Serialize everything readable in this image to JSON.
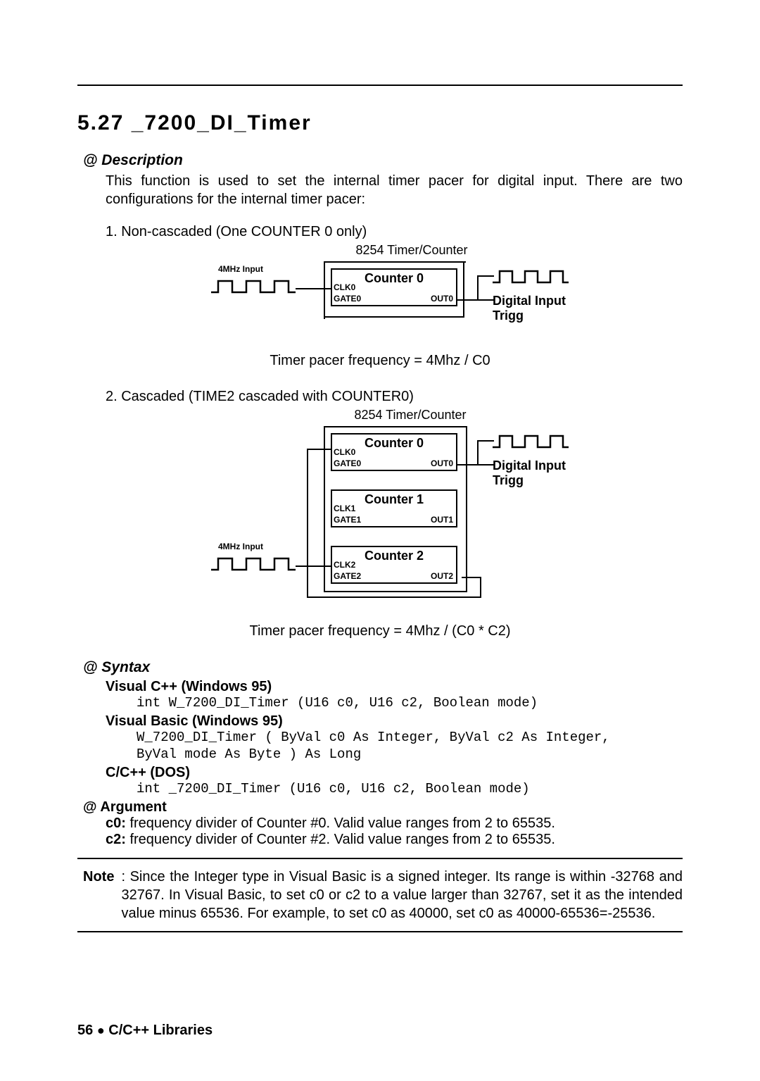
{
  "section_number": "5.27",
  "section_title": "_7200_DI_Timer",
  "description": {
    "heading": "@ Description",
    "text": "This function is used to set the internal timer pacer for digital input. There are two configurations for the internal timer pacer:"
  },
  "config1": {
    "title": "1. Non-cascaded (One COUNTER 0 only)",
    "caption": "8254 Timer/Counter",
    "input_label": "4MHz Input",
    "counter_label": "Counter 0",
    "clk": "CLK0",
    "gate": "GATE0",
    "out": "OUT0",
    "trigger": "Digital Input Trigg",
    "formula": "Timer pacer frequency = 4Mhz / C0"
  },
  "config2": {
    "title": "2. Cascaded (TIME2 cascaded with COUNTER0)",
    "caption": "8254 Timer/Counter",
    "input_label": "4MHz Input",
    "c0": {
      "label": "Counter 0",
      "clk": "CLK0",
      "gate": "GATE0",
      "out": "OUT0"
    },
    "c1": {
      "label": "Counter 1",
      "clk": "CLK1",
      "gate": "GATE1",
      "out": "OUT1"
    },
    "c2": {
      "label": "Counter 2",
      "clk": "CLK2",
      "gate": "GATE2",
      "out": "OUT2"
    },
    "trigger": "Digital Input Trigg",
    "formula": "Timer pacer frequency = 4Mhz / (C0 * C2)"
  },
  "syntax": {
    "heading": "@ Syntax",
    "vc": {
      "label": "Visual C++ (Windows 95)",
      "code": "int W_7200_DI_Timer (U16 c0, U16 c2, Boolean mode)"
    },
    "vb": {
      "label": "Visual Basic (Windows 95)",
      "code1": "W_7200_DI_Timer ( ByVal c0 As Integer, ByVal c2 As Integer,",
      "code2": "ByVal mode As Byte ) As Long"
    },
    "cc": {
      "label": "C/C++ (DOS)",
      "code": "int _7200_DI_Timer (U16 c0, U16 c2, Boolean mode)"
    }
  },
  "argument": {
    "heading": "@ Argument",
    "c0_label": "c0:",
    "c0_text": " frequency divider of Counter #0. Valid value ranges from 2 to 65535.",
    "c2_label": "c2:",
    "c2_text": " frequency divider of Counter #2. Valid value ranges from 2 to 65535."
  },
  "note": {
    "label": "Note",
    "text": ":  Since the Integer type in Visual Basic is a signed integer. Its range is within -32768 and 32767. In Visual Basic, to set c0 or c2 to a value larger than 32767, set it as the intended value minus 65536. For example, to set c0 as 40000, set c0 as 40000-65536=-25536."
  },
  "footer": {
    "page": "56",
    "title": "C/C++ Libraries"
  }
}
